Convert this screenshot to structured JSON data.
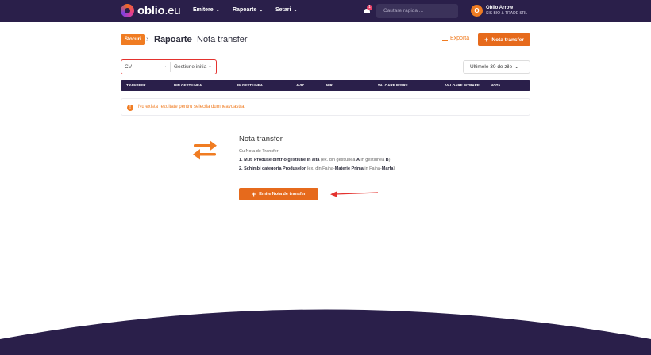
{
  "brand": {
    "name": "oblio",
    "suffix": ".eu"
  },
  "nav": {
    "items": [
      "Emitere",
      "Rapoarte",
      "Setari"
    ]
  },
  "notifications": {
    "count": "1"
  },
  "search": {
    "placeholder": "Cautare rapida ..."
  },
  "user": {
    "initial": "O",
    "name": "Oblio Arrow",
    "company": "SIS BIO & TRADE SRL"
  },
  "breadcrumb": {
    "badge": "Stocuri",
    "section": "Rapoarte",
    "title": "Nota transfer"
  },
  "actions": {
    "export": "Exporta",
    "new_transfer": "Nota transfer"
  },
  "filters": {
    "first_value": "CV",
    "second_value": "Gestiune initia",
    "range": "Ultimele 30 de zile"
  },
  "table": {
    "columns": [
      "TRANSFER",
      "DIN GESTIUNEA",
      "IN GESTIUNEA",
      "AVIZ",
      "NIR",
      "VALOARE IESIRE",
      "VALOARE INTRARE",
      "NOTA"
    ]
  },
  "alert": {
    "message": "Nu exista rezultate pentru selectia dumneavoastra."
  },
  "empty_state": {
    "title": "Nota transfer",
    "intro": "Cu Nota de Transfer:",
    "line1": {
      "num": "1. ",
      "bold": "Muti Produse dintr-o gestiune in alta",
      "paren_open": " (ex. din gestiunea ",
      "a": "A",
      "mid": " in gestiunea ",
      "b": "B",
      "paren_close": ")"
    },
    "line2": {
      "num": "2. ",
      "bold": "Schimbi categoria Produselor",
      "paren_open": " (ex. din Faina-",
      "a": "Materie Prima",
      "mid": " in Faina-",
      "b": "Marfa",
      "paren_close": ")"
    },
    "button": "Emite Nota de transfer"
  },
  "colors": {
    "nav_bg": "#2a1f4a",
    "accent": "#e66a1c",
    "highlight": "#e4322e"
  }
}
